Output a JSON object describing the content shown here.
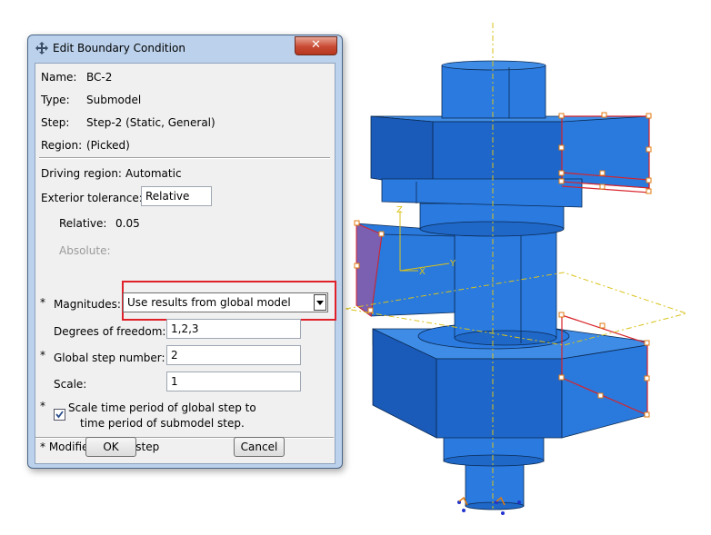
{
  "dialog": {
    "title": "Edit Boundary Condition",
    "name_label": "Name:",
    "name_value": "BC-2",
    "type_label": "Type:",
    "type_value": "Submodel",
    "step_label": "Step:",
    "step_value": "Step-2 (Static, General)",
    "region_label": "Region:",
    "region_value": "(Picked)",
    "driving_label": "Driving region:",
    "driving_value": "Automatic",
    "exterior_label": "Exterior tolerance:",
    "exterior_value": "Relative",
    "relative_label": "Relative:",
    "relative_value": "0.05",
    "absolute_label": "Absolute:",
    "asterisk": "*",
    "magnitudes_label": "Magnitudes:",
    "magnitudes_value": "Use results from global model",
    "dof_label": "Degrees of freedom:",
    "dof_value": "1,2,3",
    "global_step_label": "Global step number:",
    "global_step_value": "2",
    "scale_label": "Scale:",
    "scale_value": "1",
    "scale_time_line1": "Scale time period of global step to",
    "scale_time_line2": "time period of submodel step.",
    "modified_note": "* Modified in this step",
    "ok_label": "OK",
    "cancel_label": "Cancel",
    "close_glyph": "✕"
  },
  "viewport": {
    "triad": {
      "z_label": "Z",
      "x_label": "X",
      "y_label": "Y"
    },
    "part_color": "#1f6fd1",
    "selection_color": "#d8232a"
  }
}
